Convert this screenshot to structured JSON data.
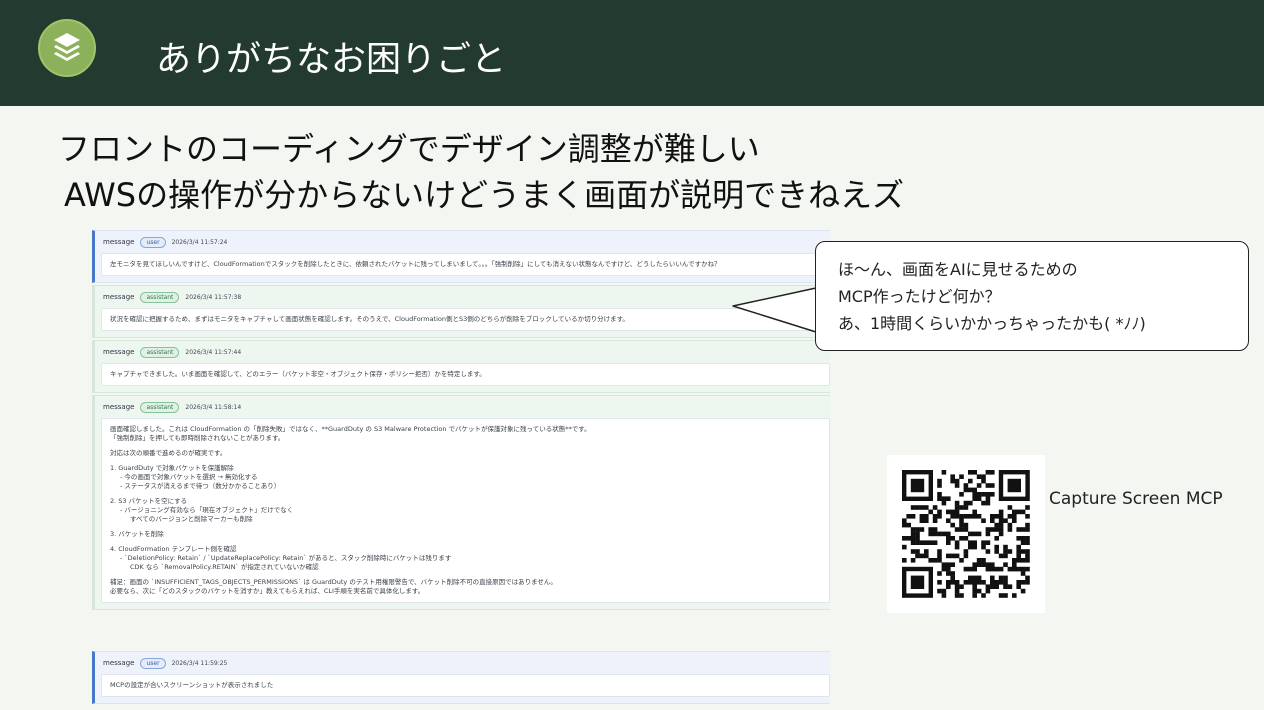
{
  "slide": {
    "title": "ありがちなお困りごと",
    "points": [
      "フロントのコーディングでデザイン調整が難しい",
      "AWSの操作が分からないけどうまく画面が説明できねえズ"
    ]
  },
  "chat": {
    "messages": [
      {
        "tag": "message",
        "role": "user",
        "time": "2026/3/4 11:57:24",
        "lines": [
          "左モニタを見てほしいんですけど、CloudFormationでスタックを削除したときに、依頼されたバケットに残ってしまいまして。。。「強制削除」にしても消えない状態なんですけど、どうしたらいいんですかね？"
        ]
      },
      {
        "tag": "message",
        "role": "assistant",
        "time": "2026/3/4 11:57:38",
        "lines": [
          "状況を確認に把握するため、まずはモニタをキャプチャして画面状態を確認します。そのうえで、CloudFormation側とS3側のどちらが削除をブロックしているか切り分けます。"
        ]
      },
      {
        "tag": "message",
        "role": "assistant",
        "time": "2026/3/4 11:57:44",
        "lines": [
          "キャプチャできました。いま画面を確認して、どのエラー（バケット非空・オブジェクト保存・ポリシー拒否）かを特定します。"
        ]
      },
      {
        "tag": "message",
        "role": "assistant",
        "time": "2026/3/4 11:58:14",
        "lines": [
          "画面確認しました。これは CloudFormation の「削除失敗」ではなく、**GuardDuty の S3 Malware Protection でバケットが保護対象に残っている状態**です。",
          "「強制削除」を押しても即時削除されないことがあります。",
          "",
          "対応は次の順番で進めるのが確実です。",
          "",
          "1. GuardDuty で対象バケットを保護解除",
          "  - 今の画面で対象バケットを選択 → 無効化する",
          "  - ステータスが消えるまで待つ（数分かかることあり）",
          "",
          "2. S3 バケットを空にする",
          "  - バージョニング有効なら「現在オブジェクト」だけでなく",
          "    すべてのバージョンと削除マーカーも削除",
          "",
          "3. バケットを削除",
          "",
          "4. CloudFormation テンプレート側を確認",
          "  - `DeletionPolicy: Retain` / `UpdateReplacePolicy: Retain` があると、スタック削除時にバケットは残ります",
          "    CDK なら `RemovalPolicy.RETAIN` が指定されていないか確認",
          "",
          "補足：画面の `INSUFFICIENT_TAGS_OBJECTS_PERMISSIONS` は GuardDuty のテスト用権限警告で、バケット削除不可の直接原因ではありません。",
          "必要なら、次に「どのスタックのバケットを消すか」教えてもらえれば、CLI手順を実名前で具体化します。"
        ]
      },
      {
        "tag": "message",
        "role": "user",
        "time": "2026/3/4 11:59:25",
        "lines": [
          "MCPの設定が合いスクリーンショットが表示されました"
        ]
      }
    ]
  },
  "bubble": {
    "lines": [
      "ほ〜ん、画面をAIに見せるための",
      "MCP作ったけど何か？",
      "あ、1時間くらいかかっちゃったかも( *ﾉﾉ)"
    ]
  },
  "qr": {
    "label": "Capture Screen MCP"
  },
  "colors": {
    "header": "#223a2f",
    "logo": "#8bb25a",
    "user_accent": "#4a78c8",
    "assistant_accent": "#3f9a55",
    "background": "#f4f7f1"
  },
  "icons": {
    "logo": "layers-icon",
    "qr": "qr-code-icon"
  }
}
